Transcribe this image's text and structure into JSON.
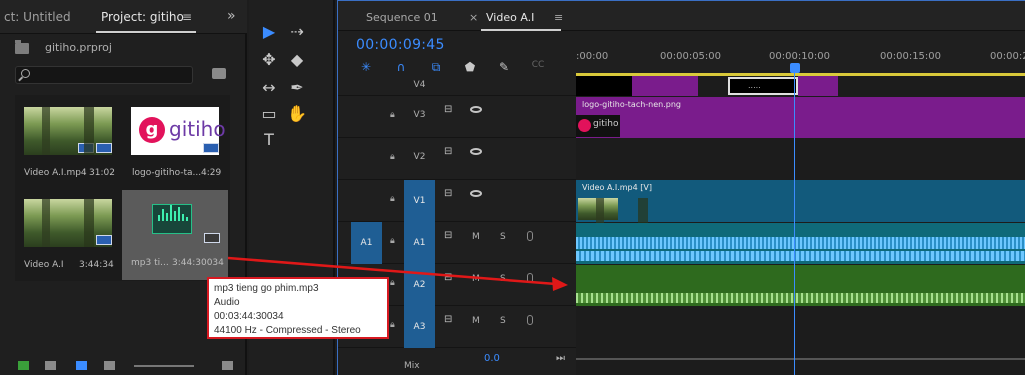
{
  "project_panel": {
    "tab_left": "ct: Untitled",
    "tab_active": "Project: gitiho",
    "menu_glyph": "≡",
    "expand_glyph": "»",
    "project_file": "gitiho.prproj",
    "items": [
      {
        "name": "Video A.I.mp4",
        "duration": "31:02"
      },
      {
        "name": "logo-gitiho-ta...",
        "duration": "4:29"
      },
      {
        "name": "Video A.I",
        "duration": "3:44:34"
      },
      {
        "name": "mp3 ti...",
        "duration": "3:44:30034"
      }
    ],
    "logo_text": "gitiho",
    "logo_letter": "g"
  },
  "tooltip": {
    "line1": "mp3 tieng go phim.mp3",
    "line2": "Audio",
    "line3": "00:03:44:30034",
    "line4": "44100 Hz - Compressed - Stereo"
  },
  "timeline": {
    "tab_sequence": "Sequence 01",
    "tab_close": "×",
    "tab_video": "Video A.I",
    "tab_menu": "≡",
    "timecode": "00:00:09:45",
    "ruler_labels": [
      ":00:00",
      "00:00:05:00",
      "00:00:10:00",
      "00:00:15:00",
      "00:00:2"
    ],
    "tracks": {
      "v4": "V4",
      "v3": "V3",
      "v2": "V2",
      "v1": "V1",
      "a1": "A1",
      "a2": "A2",
      "a3": "A3",
      "a1_source": "A1",
      "mute": "M",
      "solo": "S",
      "mix": "Mix",
      "mix_value": "0.0"
    },
    "clips": {
      "logo_clip": "logo-gitiho-tach-nen.png",
      "logo_thumb_text": "gitiho",
      "video_clip": "Video A.I.mp4 [V]",
      "v4_small_label": "....."
    }
  },
  "tools": [
    "▶",
    "⇢",
    "✥",
    "◆",
    "↔",
    "✒",
    "▭",
    "✋",
    "T"
  ],
  "colors": {
    "accent": "#3b8cff",
    "clip_purple": "#7a1c8c",
    "clip_teal": "#125a7c",
    "audio_blue": "#0f6a7a",
    "audio_green": "#2e6a1e",
    "highlight": "#d71921"
  }
}
